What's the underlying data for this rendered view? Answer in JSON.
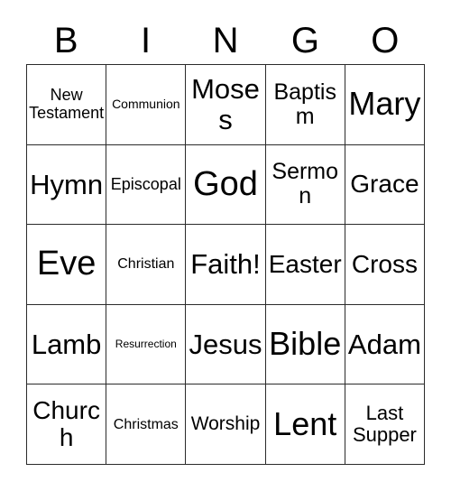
{
  "card": {
    "type": "bingo-card",
    "columns": 5,
    "rows": 5,
    "theme_colors": {
      "background": "#ffffff",
      "text": "#000000",
      "border": "#2b2b2b"
    }
  },
  "header": {
    "letters": [
      {
        "label": "B"
      },
      {
        "label": "I"
      },
      {
        "label": "N"
      },
      {
        "label": "G"
      },
      {
        "label": "O"
      }
    ]
  },
  "grid": {
    "rows": [
      {
        "cells": [
          {
            "label": "New Testament",
            "size": "md"
          },
          {
            "label": "Communion",
            "size": "sm"
          },
          {
            "label": "Moses",
            "size": "xxl"
          },
          {
            "label": "Baptism",
            "size": "lgx"
          },
          {
            "label": "Mary",
            "size": "huge"
          }
        ]
      },
      {
        "cells": [
          {
            "label": "Hymn",
            "size": "xxl"
          },
          {
            "label": "Episcopal",
            "size": "md"
          },
          {
            "label": "God",
            "size": "mega"
          },
          {
            "label": "Sermon",
            "size": "lgx"
          },
          {
            "label": "Grace",
            "size": "xl"
          }
        ]
      },
      {
        "cells": [
          {
            "label": "Eve",
            "size": "mega"
          },
          {
            "label": "Christian",
            "size": "smd"
          },
          {
            "label": "Faith!",
            "size": "xxl"
          },
          {
            "label": "Easter",
            "size": "xl"
          },
          {
            "label": "Cross",
            "size": "xl"
          }
        ]
      },
      {
        "cells": [
          {
            "label": "Lamb",
            "size": "xxl"
          },
          {
            "label": "Resurrection",
            "size": "xs"
          },
          {
            "label": "Jesus",
            "size": "xxl"
          },
          {
            "label": "Bible",
            "size": "huge"
          },
          {
            "label": "Adam",
            "size": "xxl"
          }
        ]
      },
      {
        "cells": [
          {
            "label": "Church",
            "size": "xl"
          },
          {
            "label": "Christmas",
            "size": "smd"
          },
          {
            "label": "Worship",
            "size": "mdl"
          },
          {
            "label": "Lent",
            "size": "huge"
          },
          {
            "label": "Last Supper",
            "size": "lg"
          }
        ]
      }
    ]
  }
}
